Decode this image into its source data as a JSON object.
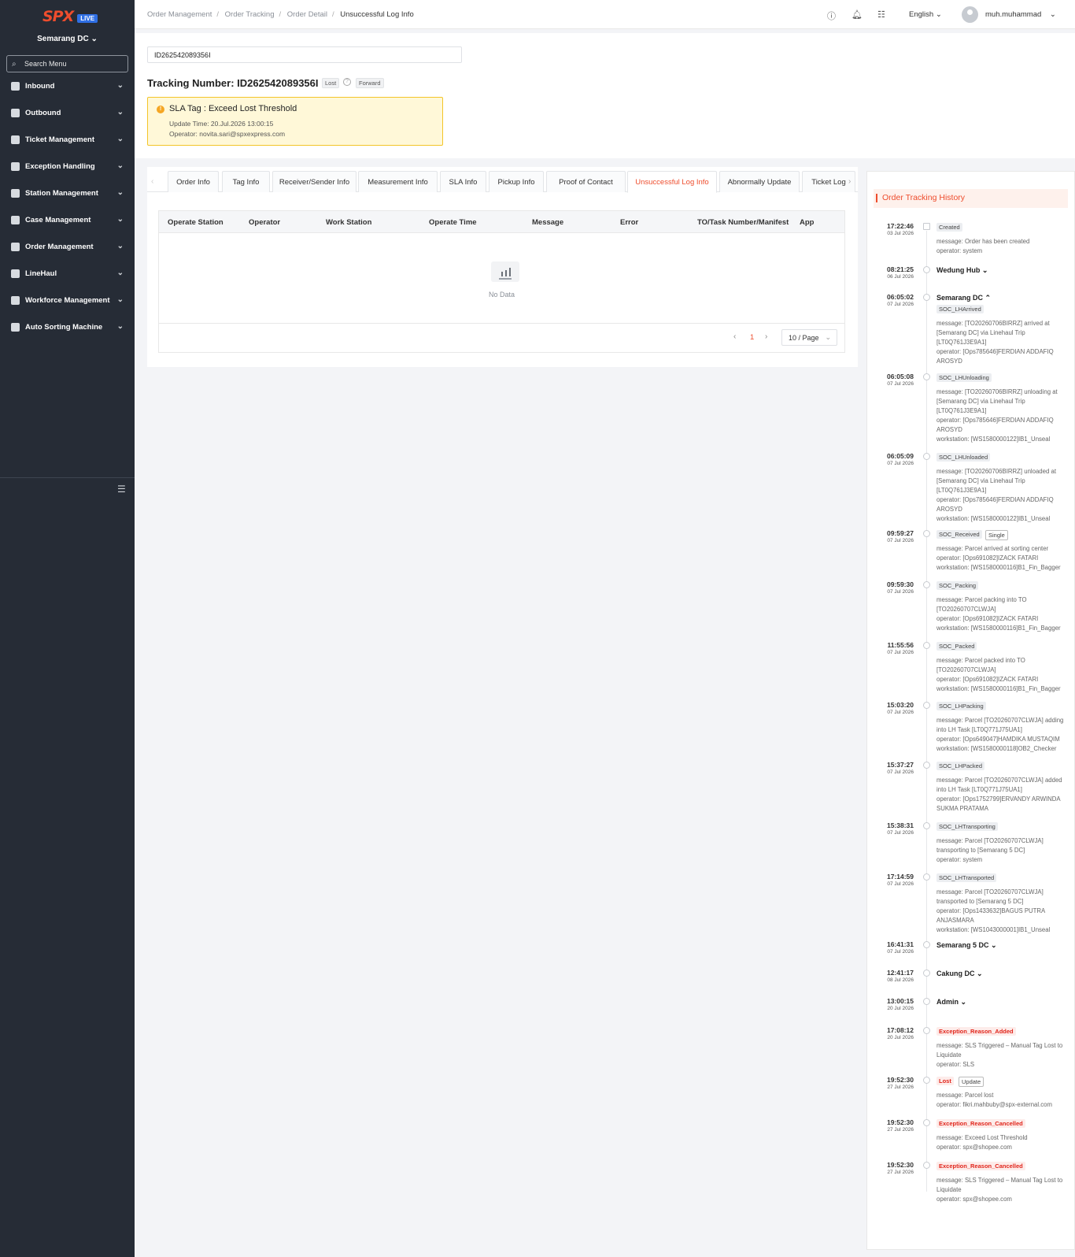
{
  "sidebar": {
    "logo": "SPX",
    "logo_badge": "LIVE",
    "dc": "Semarang DC",
    "search_placeholder": "Search Menu",
    "items": [
      {
        "label": "Inbound",
        "icon": "inbound-icon"
      },
      {
        "label": "Outbound",
        "icon": "outbound-icon"
      },
      {
        "label": "Ticket Management",
        "icon": "ticket-icon"
      },
      {
        "label": "Exception Handling",
        "icon": "exception-icon"
      },
      {
        "label": "Station Management",
        "icon": "station-icon"
      },
      {
        "label": "Case Management",
        "icon": "case-icon"
      },
      {
        "label": "Order Management",
        "icon": "order-icon"
      },
      {
        "label": "LineHaul",
        "icon": "truck-icon"
      },
      {
        "label": "Workforce Management",
        "icon": "workforce-icon"
      },
      {
        "label": "Auto Sorting Machine",
        "icon": "sorting-icon"
      }
    ]
  },
  "topbar": {
    "breadcrumb": [
      "Order Management",
      "Order Tracking",
      "Order Detail",
      "Unsuccessful Log Info"
    ],
    "language": "English",
    "username": "muh.muhammad"
  },
  "header": {
    "search_value": "ID262542089356I",
    "tracking_title": "Tracking Number: ID262542089356I",
    "tag_lost": "Lost",
    "tag_forward": "Forward",
    "sla_title": "SLA Tag : Exceed Lost Threshold",
    "sla_update": "Update Time: 20.Jul.2026 13:00:15",
    "sla_operator": "Operator: novita.sari@spxexpress.com"
  },
  "tabs": [
    "Order Info",
    "Tag Info",
    "Receiver/Sender Info",
    "Measurement Info",
    "SLA Info",
    "Pickup Info",
    "Proof of Contact",
    "Unsuccessful Log Info",
    "Abnormally Update",
    "Ticket Log"
  ],
  "active_tab": "Unsuccessful Log Info",
  "table": {
    "columns": [
      "Operate Station",
      "Operator",
      "Work Station",
      "Operate Time",
      "Message",
      "Error",
      "TO/Task Number/Manifest",
      "App"
    ],
    "empty_text": "No Data",
    "page": "1",
    "page_size": "10 / Page"
  },
  "history": {
    "title": "Order Tracking History",
    "events": [
      {
        "time": "17:22:46",
        "date": "03 Jul 2026",
        "tag": "Created",
        "lines": [
          "message: Order has been created",
          "operator: system"
        ]
      },
      {
        "time": "08:21:25",
        "date": "06 Jul 2026",
        "station": "Wedung Hub"
      },
      {
        "time": "06:05:02",
        "date": "07 Jul 2026",
        "station": "Semarang DC",
        "tag": "SOC_LHArrived",
        "lines": [
          "message: [TO20260706BIRRZ] arrived at",
          "[Semarang DC] via Linehaul Trip",
          "[LT0Q761J3E9A1]",
          "operator: [Ops785646]FERDIAN ADDAFIQ",
          "AROSYD"
        ]
      },
      {
        "time": "06:05:08",
        "date": "07 Jul 2026",
        "tag": "SOC_LHUnloading",
        "lines": [
          "message: [TO20260706BIRRZ] unloading at",
          "[Semarang DC] via Linehaul Trip",
          "[LT0Q761J3E9A1]",
          "operator: [Ops785646]FERDIAN ADDAFIQ",
          "AROSYD",
          "workstation: [WS1580000122]IB1_Unseal"
        ]
      },
      {
        "time": "06:05:09",
        "date": "07 Jul 2026",
        "tag": "SOC_LHUnloaded",
        "lines": [
          "message: [TO20260706BIRRZ] unloaded at",
          "[Semarang DC] via Linehaul Trip",
          "[LT0Q761J3E9A1]",
          "operator: [Ops785646]FERDIAN ADDAFIQ",
          "AROSYD",
          "workstation: [WS1580000122]IB1_Unseal"
        ]
      },
      {
        "time": "09:59:27",
        "date": "07 Jul 2026",
        "tag": "SOC_Received",
        "tag2": "Single",
        "lines": [
          "message: Parcel arrived at sorting center",
          "operator: [Ops691082]IZACK FATARI",
          "workstation: [WS1580000116]B1_Fin_Bagger"
        ]
      },
      {
        "time": "09:59:30",
        "date": "07 Jul 2026",
        "tag": "SOC_Packing",
        "lines": [
          "message: Parcel packing into TO",
          "[TO20260707CLWJA]",
          "operator: [Ops691082]IZACK FATARI",
          "workstation: [WS1580000116]B1_Fin_Bagger"
        ]
      },
      {
        "time": "11:55:56",
        "date": "07 Jul 2026",
        "tag": "SOC_Packed",
        "lines": [
          "message: Parcel packed into TO",
          "[TO20260707CLWJA]",
          "operator: [Ops691082]IZACK FATARI",
          "workstation: [WS1580000116]B1_Fin_Bagger"
        ]
      },
      {
        "time": "15:03:20",
        "date": "07 Jul 2026",
        "tag": "SOC_LHPacking",
        "lines": [
          "message: Parcel [TO20260707CLWJA] adding",
          "into LH Task [LT0Q771J75UA1]",
          "operator: [Ops649047]HAMDIKA MUSTAQIM",
          "workstation: [WS1580000118]OB2_Checker"
        ]
      },
      {
        "time": "15:37:27",
        "date": "07 Jul 2026",
        "tag": "SOC_LHPacked",
        "lines": [
          "message: Parcel [TO20260707CLWJA] added",
          "into LH Task [LT0Q771J75UA1]",
          "operator: [Ops1752799]ERVANDY ARWINDA",
          "SUKMA PRATAMA"
        ]
      },
      {
        "time": "15:38:31",
        "date": "07 Jul 2026",
        "tag": "SOC_LHTransporting",
        "lines": [
          "message: Parcel [TO20260707CLWJA]",
          "transporting to [Semarang 5 DC]",
          "operator: system"
        ]
      },
      {
        "time": "17:14:59",
        "date": "07 Jul 2026",
        "tag": "SOC_LHTransported",
        "lines": [
          "message: Parcel [TO20260707CLWJA]",
          "transported to [Semarang 5 DC]",
          "operator: [Ops1433632]BAGUS PUTRA",
          "ANJASMARA",
          "workstation: [WS1043000001]IB1_Unseal"
        ]
      },
      {
        "time": "16:41:31",
        "date": "07 Jul 2026",
        "station": "Semarang 5 DC"
      },
      {
        "time": "12:41:17",
        "date": "08 Jul 2026",
        "station": "Cakung DC"
      },
      {
        "time": "13:00:15",
        "date": "20 Jul 2026",
        "station": "Admin"
      },
      {
        "time": "17:08:12",
        "date": "20 Jul 2026",
        "tag": "Exception_Reason_Added",
        "red": true,
        "lines": [
          "message: SLS Triggered – Manual Tag Lost to",
          "Liquidate",
          "operator: SLS"
        ]
      },
      {
        "time": "19:52:30",
        "date": "27 Jul 2026",
        "tag": "Lost",
        "red": true,
        "tag2": "Update",
        "lines": [
          "message: Parcel lost",
          "operator: fikri.mahbuby@spx-external.com"
        ]
      },
      {
        "time": "19:52:30",
        "date": "27 Jul 2026",
        "tag": "Exception_Reason_Cancelled",
        "red": true,
        "lines": [
          "message: Exceed Lost Threshold",
          "operator: spx@shopee.com"
        ]
      },
      {
        "time": "19:52:30",
        "date": "27 Jul 2026",
        "tag": "Exception_Reason_Cancelled",
        "red": true,
        "lines": [
          "message: SLS Triggered – Manual Tag Lost to",
          "Liquidate",
          "operator: spx@shopee.com"
        ]
      }
    ]
  }
}
